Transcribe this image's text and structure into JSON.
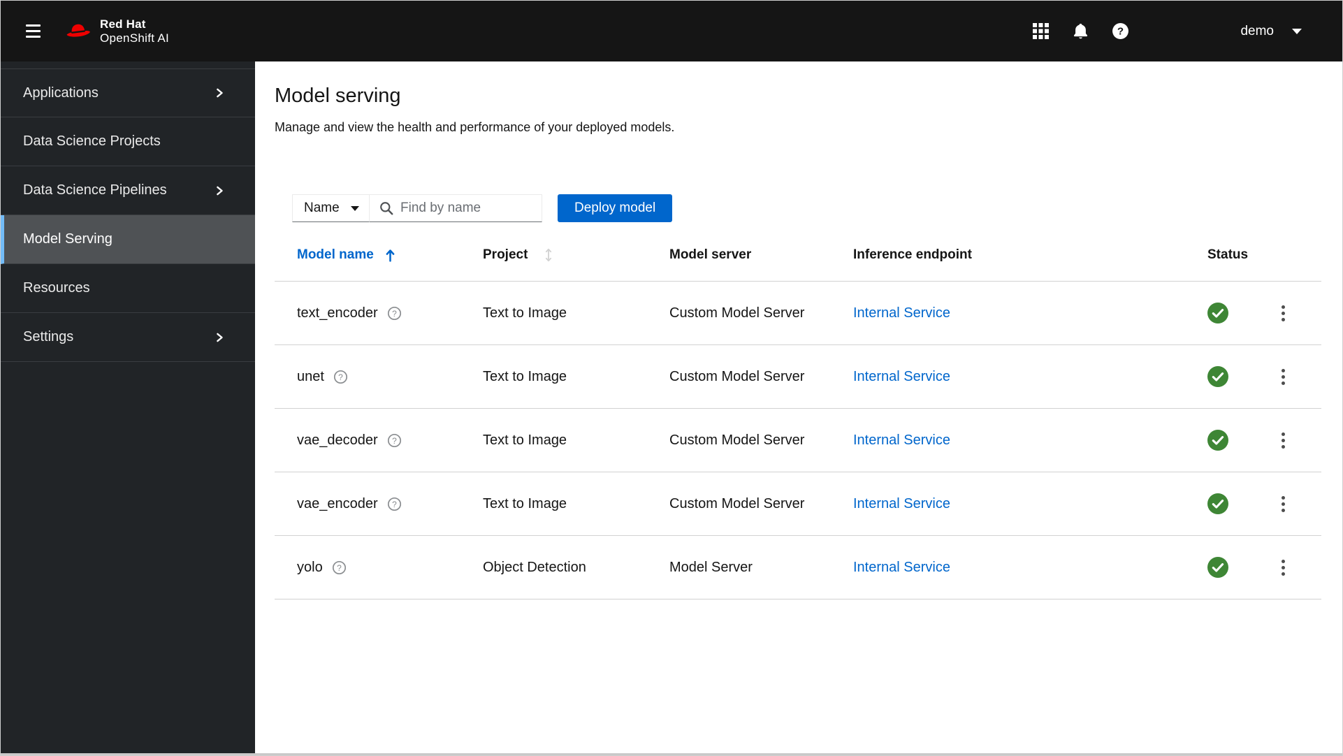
{
  "masthead": {
    "brand_line1": "Red Hat",
    "brand_line2": "OpenShift AI",
    "icons": [
      {
        "name": "app-launcher",
        "glyph": "grid-3x3"
      },
      {
        "name": "notifications",
        "glyph": "bell"
      },
      {
        "name": "help",
        "glyph": "question-circle"
      }
    ],
    "username": "demo"
  },
  "sidebar": {
    "items": [
      {
        "label": "Applications",
        "expandable": true,
        "active": false
      },
      {
        "label": "Data Science Projects",
        "expandable": false,
        "active": false
      },
      {
        "label": "Data Science Pipelines",
        "expandable": true,
        "active": false
      },
      {
        "label": "Model Serving",
        "expandable": false,
        "active": true
      },
      {
        "label": "Resources",
        "expandable": false,
        "active": false
      },
      {
        "label": "Settings",
        "expandable": true,
        "active": false
      }
    ]
  },
  "page": {
    "title": "Model serving",
    "subtitle": "Manage and view the health and performance of your deployed models."
  },
  "toolbar": {
    "filter_selected": "Name",
    "search_placeholder": "Find by name",
    "search_value": "",
    "deploy_button_label": "Deploy model"
  },
  "table": {
    "columns": [
      {
        "label": "Model name",
        "sort": "ascending",
        "sort_icon": "long-arrow-up"
      },
      {
        "label": "Project",
        "sort": "none",
        "sort_icon": "arrows-up-down"
      },
      {
        "label": "Model server"
      },
      {
        "label": "Inference endpoint"
      },
      {
        "label": "Status"
      }
    ],
    "rows": [
      {
        "name": "text_encoder",
        "project": "Text to Image",
        "server": "Custom Model Server",
        "endpoint": "Internal Service",
        "status": "success"
      },
      {
        "name": "unet",
        "project": "Text to Image",
        "server": "Custom Model Server",
        "endpoint": "Internal Service",
        "status": "success"
      },
      {
        "name": "vae_decoder",
        "project": "Text to Image",
        "server": "Custom Model Server",
        "endpoint": "Internal Service",
        "status": "success"
      },
      {
        "name": "vae_encoder",
        "project": "Text to Image",
        "server": "Custom Model Server",
        "endpoint": "Internal Service",
        "status": "success"
      },
      {
        "name": "yolo",
        "project": "Object Detection",
        "server": "Model Server",
        "endpoint": "Internal Service",
        "status": "success"
      }
    ]
  },
  "colors": {
    "masthead_bg": "#151515",
    "sidebar_bg": "#212427",
    "sidebar_active_bg": "#4f5255",
    "sidebar_active_indicator": "#73bcf7",
    "primary_blue": "#0066cc",
    "link_blue": "#0066cc",
    "success_green": "#3e8635",
    "brand_red": "#ee0000",
    "row_border": "#d2d2d2",
    "muted_text": "#6a6e73"
  }
}
